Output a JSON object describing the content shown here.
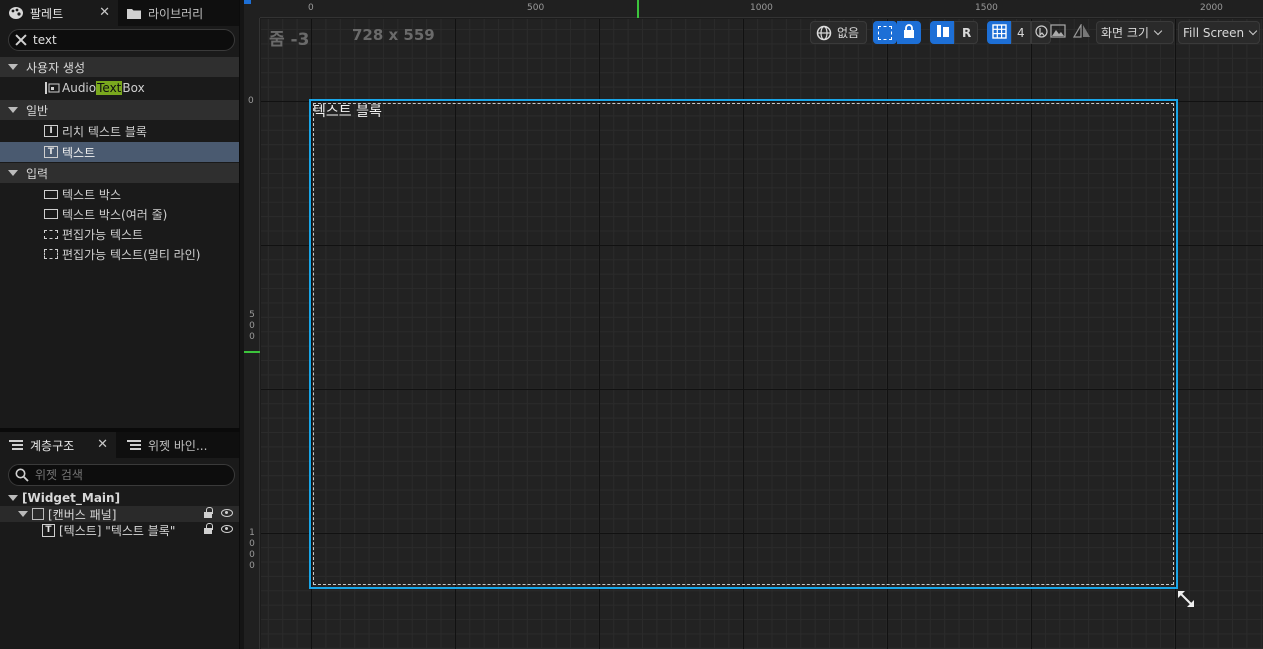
{
  "palette": {
    "tab_palette": "팔레트",
    "tab_library": "라이브러리",
    "search_value": "text",
    "categories": [
      {
        "label": "사용자 생성",
        "items": [
          {
            "pre": "Audio ",
            "hl": "Text",
            "post": " Box"
          }
        ]
      },
      {
        "label": "일반",
        "items": [
          {
            "label": "리치 텍스트 블록"
          },
          {
            "label": "텍스트"
          }
        ]
      },
      {
        "label": "입력",
        "items": [
          {
            "label": "텍스트 박스"
          },
          {
            "label": "텍스트 박스(여러 줄)"
          },
          {
            "label": "편집가능 텍스트"
          },
          {
            "label": "편집가능 텍스트(멀티 라인)"
          }
        ]
      }
    ]
  },
  "hierarchy": {
    "tab_hierarchy": "계층구조",
    "tab_bindings": "위젯 바인...",
    "search_placeholder": "위젯 검색",
    "root": "[Widget_Main]",
    "canvas": "[캔버스 패널]",
    "text": "[텍스트] \"텍스트 블록\""
  },
  "viewport": {
    "zoom": "줌 -3",
    "resolution": "728 x 559",
    "ruler_h": [
      "0",
      "500",
      "1000",
      "1500",
      "2000"
    ],
    "ruler_v": [
      "0",
      "500",
      "1000"
    ],
    "text_block": "텍스트 블록",
    "toolbar": {
      "locale": "없음",
      "respect_label": "R",
      "grid_size": "4",
      "screen_size": "화면 크기",
      "fill_mode": "Fill Screen"
    }
  }
}
